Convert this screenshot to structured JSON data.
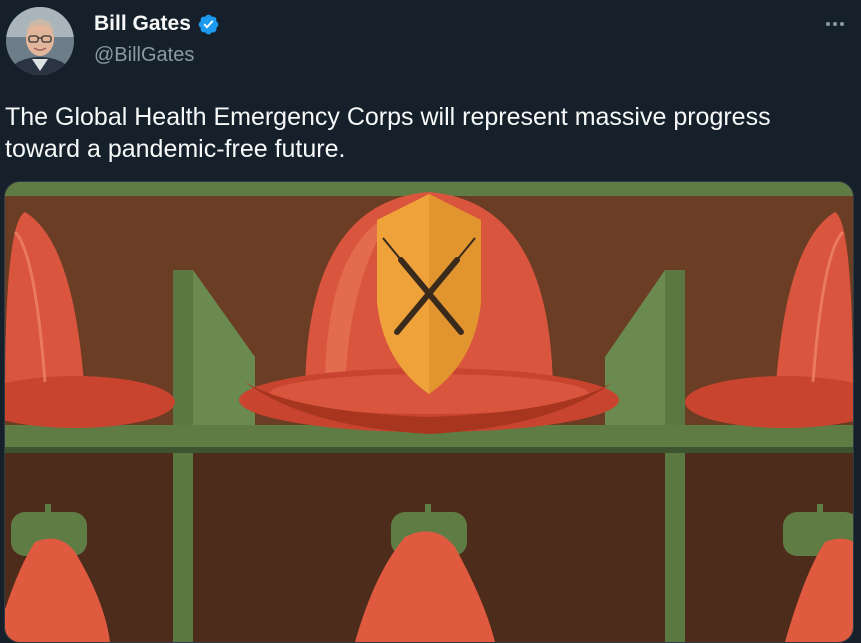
{
  "author": {
    "display_name": "Bill Gates",
    "handle": "@BillGates",
    "verified": true,
    "avatar_icon": "profile-photo"
  },
  "tweet": {
    "text": "The Global Health Emergency Corps will represent massive progress\ntoward a pandemic-free future."
  },
  "menu": {
    "icon": "more-horizontal-icon"
  },
  "media": {
    "description_icon": "illustration",
    "colors": {
      "background": "#5a3520",
      "shelf": "#5f7c45",
      "helmet": "#d9553e",
      "shield": "#f0a23a"
    }
  },
  "colors": {
    "background": "#15202b",
    "text_primary": "#f7f9f9",
    "text_secondary": "#8b98a5",
    "verified_badge": "#1d9bf0"
  }
}
